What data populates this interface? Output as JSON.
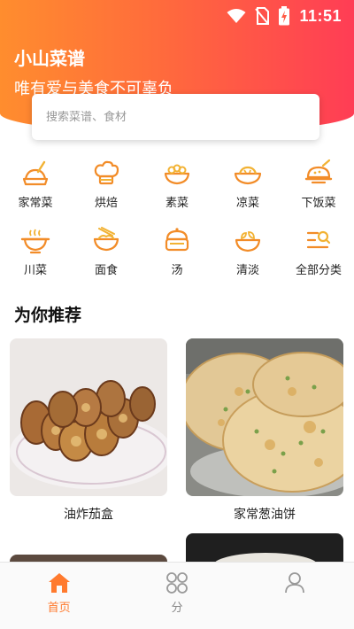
{
  "status_bar": {
    "time": "11:51"
  },
  "header": {
    "title": "小山菜谱",
    "subtitle": "唯有爱与美食不可辜负"
  },
  "search": {
    "placeholder": "搜索菜谱、食材"
  },
  "categories": [
    {
      "label": "家常菜",
      "icon": "home-dish-icon"
    },
    {
      "label": "烘焙",
      "icon": "chef-hat-icon"
    },
    {
      "label": "素菜",
      "icon": "veg-bowl-icon"
    },
    {
      "label": "凉菜",
      "icon": "cold-dish-icon"
    },
    {
      "label": "下饭菜",
      "icon": "rice-dish-icon"
    },
    {
      "label": "川菜",
      "icon": "hotpot-icon"
    },
    {
      "label": "面食",
      "icon": "noodle-bowl-icon"
    },
    {
      "label": "汤",
      "icon": "soup-pot-icon"
    },
    {
      "label": "清淡",
      "icon": "light-dish-icon"
    },
    {
      "label": "全部分类",
      "icon": "all-categories-icon"
    }
  ],
  "recommend": {
    "title": "为你推荐",
    "items": [
      {
        "caption": "油炸茄盒"
      },
      {
        "caption": "家常葱油饼"
      }
    ]
  },
  "bottom_nav": [
    {
      "label": "首页",
      "icon": "home-icon",
      "active": true
    },
    {
      "label": "分",
      "icon": "category-grid-icon",
      "active": false
    },
    {
      "label": "",
      "icon": "profile-icon",
      "active": false
    }
  ],
  "colors": {
    "accent": "#ff7a2e",
    "header_gradient_start": "#ff8d2e",
    "header_gradient_end": "#ff3d55"
  }
}
